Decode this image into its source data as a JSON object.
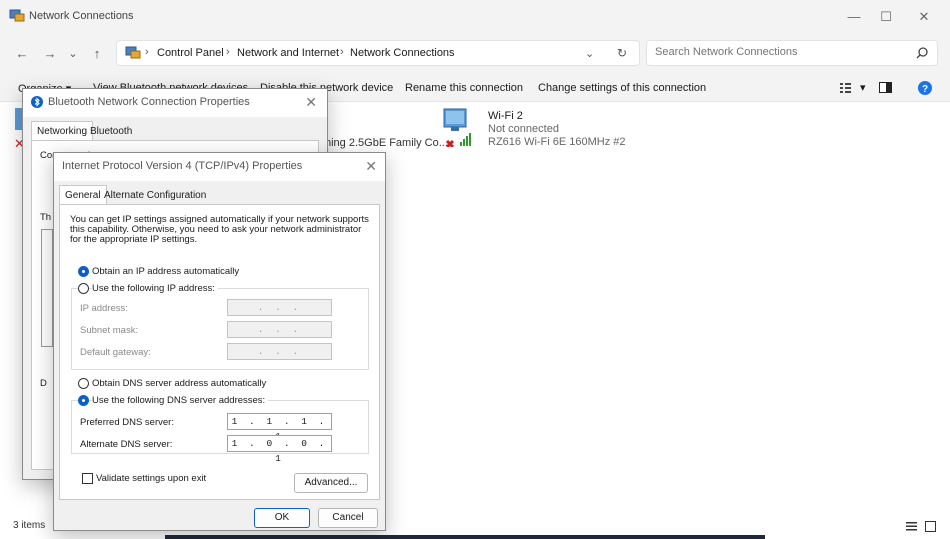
{
  "window": {
    "title": "Network Connections",
    "minimize_glyph": "—",
    "maximize_glyph": "☐",
    "close_glyph": "✕"
  },
  "nav": {
    "back_glyph": "←",
    "forward_glyph": "→",
    "recent_glyph": "⌄",
    "up_glyph": "↑",
    "breadcrumbs": [
      "Control Panel",
      "Network and Internet",
      "Network Connections"
    ],
    "crumb_sep": "›",
    "dropdown_glyph": "⌄",
    "refresh_glyph": "↻",
    "search_placeholder": "Search Network Connections"
  },
  "commands": {
    "organize": "Organize ▾",
    "view_bluetooth": "View Bluetooth network devices",
    "disable": "Disable this network device",
    "rename": "Rename this connection",
    "change_settings": "Change settings of this connection",
    "view_options_glyph": "▾"
  },
  "connections": {
    "ethernet_partial": "ning 2.5GbE Family Co...",
    "wifi": {
      "name": "Wi-Fi 2",
      "status": "Not connected",
      "device": "RZ616 Wi-Fi 6E 160MHz #2"
    }
  },
  "statusbar": {
    "items": "3 items"
  },
  "bt_dialog": {
    "title": "Bluetooth Network Connection Properties",
    "tabs": [
      "Networking",
      "Bluetooth"
    ],
    "connect_using_partial": "Connect using:",
    "this_partial": "Th",
    "d_partial": "D"
  },
  "ipv4": {
    "title": "Internet Protocol Version 4 (TCP/IPv4) Properties",
    "tabs": [
      "General",
      "Alternate Configuration"
    ],
    "description_lines": [
      "You can get IP settings assigned automatically if your network supports",
      "this capability. Otherwise, you need to ask your network administrator",
      "for the appropriate IP settings."
    ],
    "obtain_ip_auto": "Obtain an IP address automatically",
    "use_following_ip": "Use the following IP address:",
    "ip_address_label": "IP address:",
    "subnet_label": "Subnet mask:",
    "gateway_label": "Default gateway:",
    "empty_ip": ".     .     .",
    "obtain_dns_auto": "Obtain DNS server address automatically",
    "use_following_dns": "Use the following DNS server addresses:",
    "preferred_dns_label": "Preferred DNS server:",
    "preferred_dns_value": "1 . 1 . 1 . 1",
    "alternate_dns_label": "Alternate DNS server:",
    "alternate_dns_value": "1 . 0 . 0 . 1",
    "validate_label": "Validate settings upon exit",
    "advanced_button": "Advanced...",
    "ok_button": "OK",
    "cancel_button": "Cancel",
    "close_glyph": "✕"
  },
  "colors": {
    "accent": "#0a62c9",
    "error_red": "#d21c1c",
    "signal_green": "#2a9d2a"
  }
}
